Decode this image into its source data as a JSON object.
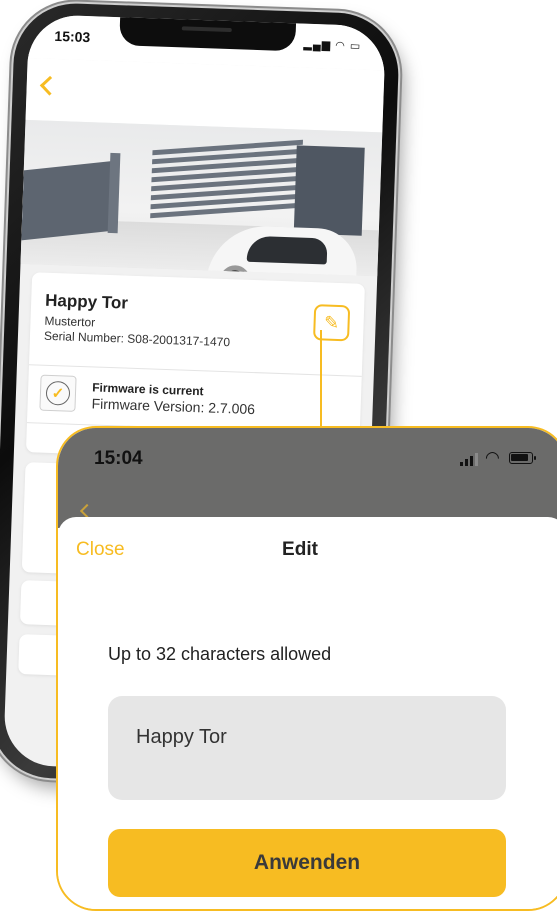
{
  "back_screen": {
    "status_time": "15:03",
    "device": {
      "name": "Happy Tor",
      "model": "Mustertor",
      "serial": "Serial Number: S08-2001317-1470"
    },
    "firmware": {
      "status": "Firmware is current",
      "version": "Firmware Version: 2.7.006"
    }
  },
  "front_screen": {
    "status_time": "15:04",
    "edit_sheet": {
      "close_label": "Close",
      "title": "Edit",
      "hint": "Up to 32 characters allowed",
      "name_value": "Happy Tor",
      "apply_label": "Anwenden"
    }
  },
  "colors": {
    "accent": "#f7bc22",
    "dim_overlay": "#6b6b6a",
    "field_bg": "#e6e6e6"
  },
  "icons": {
    "back": "chevron-left-icon",
    "edit": "pencil-icon",
    "firmware": "check-circle-icon",
    "signal": "signal-icon",
    "wifi": "wifi-icon",
    "battery": "battery-icon"
  }
}
